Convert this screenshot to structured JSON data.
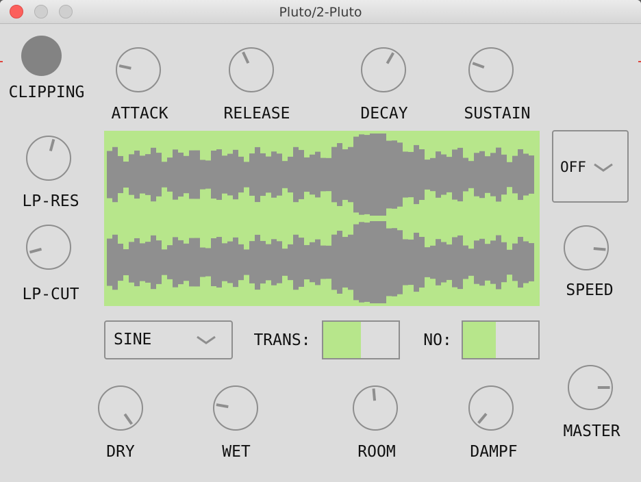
{
  "window": {
    "title": "Pluto/2-Pluto"
  },
  "clipping": {
    "label": "CLIPPING"
  },
  "envelope": {
    "attack": {
      "label": "ATTACK",
      "angle": -78
    },
    "release": {
      "label": "RELEASE",
      "angle": -25
    },
    "decay": {
      "label": "DECAY",
      "angle": 30
    },
    "sustain": {
      "label": "SUSTAIN",
      "angle": -70
    }
  },
  "filter": {
    "lp_res": {
      "label": "LP-RES",
      "angle": 15
    },
    "lp_cut": {
      "label": "LP-CUT",
      "angle": -105
    }
  },
  "mode_select": {
    "value": "OFF"
  },
  "speed": {
    "label": "SPEED",
    "angle": 95
  },
  "waveform_select": {
    "value": "SINE"
  },
  "trans": {
    "label": "TRANS:",
    "level": 0.5
  },
  "no": {
    "label": "NO:",
    "level": 0.44
  },
  "reverb": {
    "dry": {
      "label": "DRY",
      "angle": 145
    },
    "wet": {
      "label": "WET",
      "angle": -80
    },
    "room": {
      "label": "ROOM",
      "angle": -5
    },
    "dampf": {
      "label": "DAMPF",
      "angle": -140
    }
  },
  "master": {
    "label": "MASTER",
    "angle": 90
  },
  "colors": {
    "accent": "#b7e68b",
    "wave": "#8f8f8f",
    "panel": "#dcdcdc"
  }
}
